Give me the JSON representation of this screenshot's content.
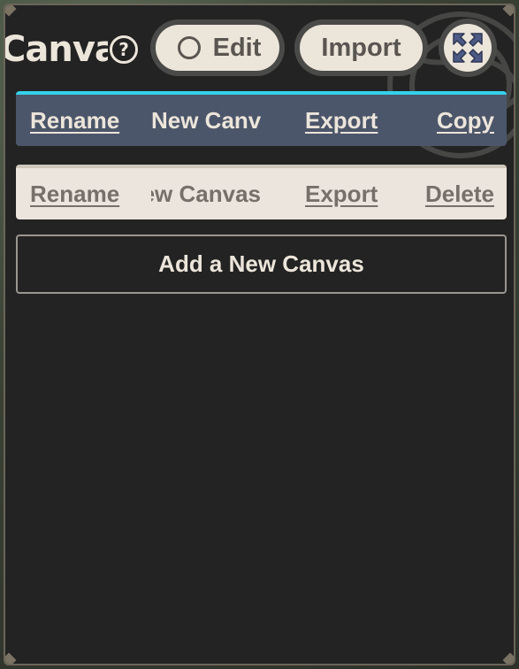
{
  "header": {
    "title": "Canvas",
    "help_glyph": "?",
    "edit_label": "Edit",
    "import_label": "Import",
    "expand_icon": "expand-arrows-icon"
  },
  "canvases": [
    {
      "rename_label": "Rename",
      "name": "New Canvas",
      "export_label": "Export",
      "action_label": "Copy",
      "selected": true
    },
    {
      "rename_label": "Rename",
      "name": "New Canvas",
      "export_label": "Export",
      "action_label": "Delete",
      "selected": false
    }
  ],
  "add_label": "Add a New Canvas",
  "colors": {
    "panel": "#232323",
    "cream": "#ece5da",
    "selected_row": "#4c566a",
    "accent": "#35d0ea",
    "expand_icon": "#4d5a86"
  }
}
